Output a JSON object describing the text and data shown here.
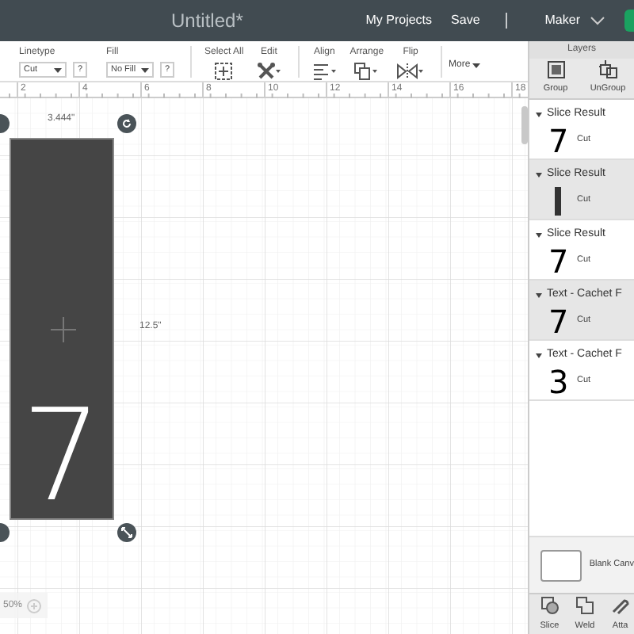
{
  "header": {
    "title": "Untitled*",
    "links": [
      "My Projects",
      "Save"
    ],
    "machine": "Maker"
  },
  "toolbar": {
    "linetype": {
      "label": "Linetype",
      "value": "Cut",
      "help": "?"
    },
    "fill": {
      "label": "Fill",
      "value": "No Fill",
      "help": "?"
    },
    "tools": [
      {
        "label": "Select All",
        "kind": "select"
      },
      {
        "label": "Edit",
        "kind": "edit"
      },
      {
        "label": "Align",
        "kind": "align"
      },
      {
        "label": "Arrange",
        "kind": "arrange"
      },
      {
        "label": "Flip",
        "kind": "flip"
      }
    ],
    "more": "More"
  },
  "canvas": {
    "ruler_labels": [
      "2",
      "4",
      "6",
      "8",
      "10",
      "12",
      "14",
      "16",
      "18"
    ],
    "width_label": "3.444\"",
    "height_label": "12.5\"",
    "shape_text": "7",
    "zoom": "50%"
  },
  "layers": {
    "title": "Layers",
    "actions": [
      {
        "label": "Group",
        "kind": "group"
      },
      {
        "label": "UnGroup",
        "kind": "ungroup"
      }
    ],
    "items": [
      {
        "title": "Slice Result",
        "kind": "glyph",
        "glyph": "7",
        "operation": "Cut",
        "selected": false
      },
      {
        "title": "Slice Result",
        "kind": "bar",
        "operation": "Cut",
        "selected": true
      },
      {
        "title": "Slice Result",
        "kind": "glyph",
        "glyph": "7",
        "operation": "Cut",
        "selected": false
      },
      {
        "title": "Text - Cachet F",
        "kind": "glyph",
        "glyph": "7",
        "operation": "Cut",
        "selected": true
      },
      {
        "title": "Text - Cachet F",
        "kind": "glyph",
        "glyph": "3",
        "operation": "Cut",
        "selected": false
      }
    ],
    "blank_canvas": "Blank Canv",
    "bottom_tools": [
      {
        "label": "Slice",
        "kind": "slice"
      },
      {
        "label": "Weld",
        "kind": "weld"
      },
      {
        "label": "Atta",
        "kind": "attach"
      }
    ]
  }
}
